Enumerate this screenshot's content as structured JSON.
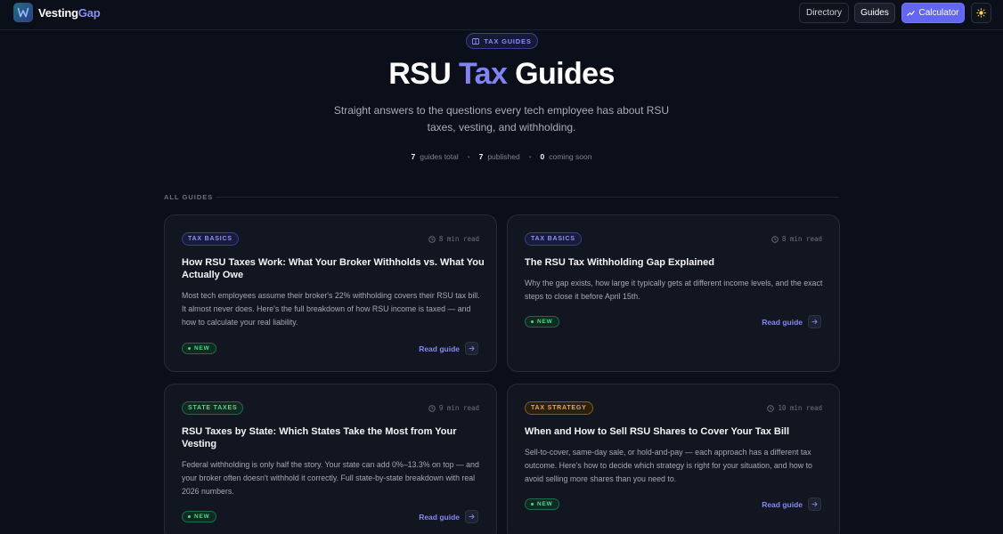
{
  "header": {
    "brand_part1": "Vesting",
    "brand_part2": "Gap",
    "nav": {
      "directory": "Directory",
      "guides": "Guides",
      "calculator": "Calculator"
    }
  },
  "hero": {
    "pill": "TAX GUIDES",
    "title_part1": "RSU ",
    "title_accent": "Tax",
    "title_part2": " Guides",
    "subtitle": "Straight answers to the questions every tech employee has about RSU taxes, vesting, and withholding.",
    "stats": [
      {
        "num": "7",
        "label": "guides total"
      },
      {
        "num": "7",
        "label": "published"
      },
      {
        "num": "0",
        "label": "coming soon"
      }
    ]
  },
  "section_label": "ALL GUIDES",
  "cards": [
    {
      "tag": "TAX BASICS",
      "read_time": "8 min read",
      "title": "How RSU Taxes Work: What Your Broker Withholds vs. What You Actually Owe",
      "description": "Most tech employees assume their broker's 22% withholding covers their RSU tax bill. It almost never does. Here's the full breakdown of how RSU income is taxed — and how to calculate your real liability.",
      "badge": "NEW",
      "link": "Read guide"
    },
    {
      "tag": "TAX BASICS",
      "read_time": "8 min read",
      "title": "The RSU Tax Withholding Gap Explained",
      "description": "Why the gap exists, how large it typically gets at different income levels, and the exact steps to close it before April 15th.",
      "badge": "NEW",
      "link": "Read guide"
    },
    {
      "tag": "STATE TAXES",
      "read_time": "9 min read",
      "title": "RSU Taxes by State: Which States Take the Most from Your Vesting",
      "description": "Federal withholding is only half the story. Your state can add 0%–13.3% on top — and your broker often doesn't withhold it correctly. Full state-by-state breakdown with real 2026 numbers.",
      "badge": "NEW",
      "link": "Read guide"
    },
    {
      "tag": "TAX STRATEGY",
      "read_time": "10 min read",
      "title": "When and How to Sell RSU Shares to Cover Your Tax Bill",
      "description": "Sell-to-cover, same-day sale, or hold-and-pay — each approach has a different tax outcome. Here's how to decide which strategy is right for your situation, and how to avoid selling more shares than you need to.",
      "badge": "NEW",
      "link": "Read guide"
    }
  ],
  "colors": {
    "background": "#0b0f19",
    "accent": "#6366f1",
    "card_bg": "#121620",
    "green": "#4ade80",
    "amber": "#f0a73a"
  },
  "icons": [
    "logo-w-icon",
    "chart-icon",
    "sun-icon",
    "book-icon",
    "clock-icon",
    "arrow-right-icon"
  ]
}
